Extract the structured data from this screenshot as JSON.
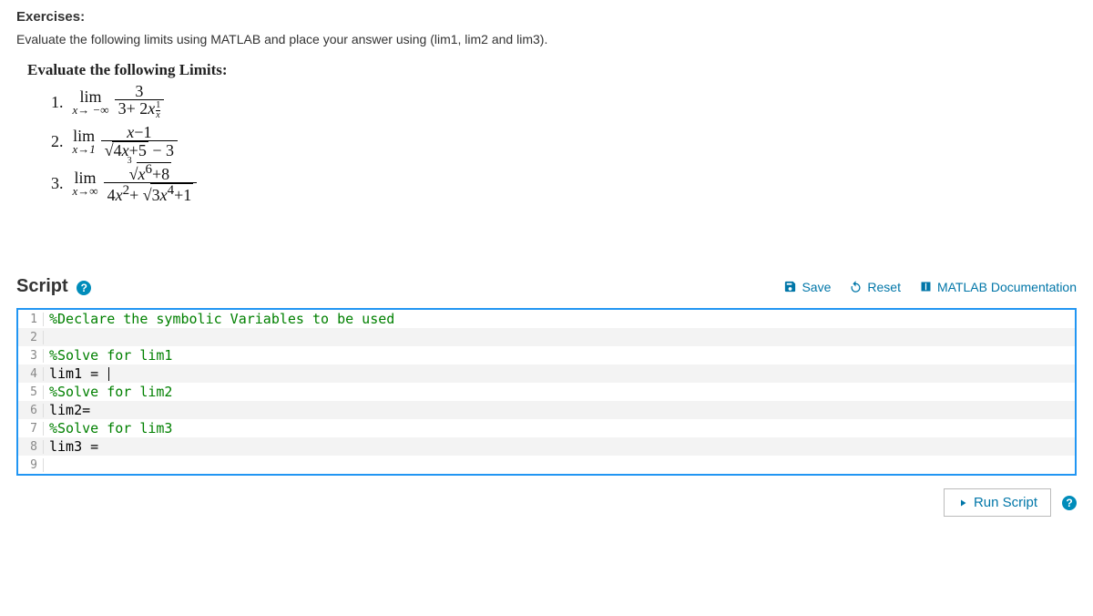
{
  "header": {
    "title": "Exercises:",
    "desc": "Evaluate the following limits using MATLAB and place your answer using (lim1, lim2 and lim3)."
  },
  "math": {
    "title": "Evaluate the following Limits:",
    "items": [
      {
        "n": "1.",
        "approach": "x→ −∞",
        "expr_top": "3",
        "expr_bot": "3 + 2x^(1/x)"
      },
      {
        "n": "2.",
        "approach": "x→1",
        "expr_top": "x − 1",
        "expr_bot": "√(4x+5) − 3"
      },
      {
        "n": "3.",
        "approach": "x→∞",
        "expr_top": "∛(x^6 + 8)",
        "expr_bot": "4x^2 + √(3x^4 + 1)"
      }
    ]
  },
  "script": {
    "title": "Script"
  },
  "toolbar": {
    "save": "Save",
    "reset": "Reset",
    "docs": "MATLAB Documentation",
    "run": "Run Script"
  },
  "editor": {
    "lines": [
      {
        "n": 1,
        "type": "comment",
        "text": "%Declare the symbolic Variables to be used"
      },
      {
        "n": 2,
        "type": "plain",
        "text": ""
      },
      {
        "n": 3,
        "type": "comment",
        "text": "%Solve for lim1"
      },
      {
        "n": 4,
        "type": "plain",
        "text": "lim1 = ",
        "cursor": true
      },
      {
        "n": 5,
        "type": "comment",
        "text": "%Solve for lim2"
      },
      {
        "n": 6,
        "type": "plain",
        "text": "lim2="
      },
      {
        "n": 7,
        "type": "comment",
        "text": "%Solve for lim3"
      },
      {
        "n": 8,
        "type": "plain",
        "text": "lim3 = "
      },
      {
        "n": 9,
        "type": "plain",
        "text": ""
      }
    ]
  }
}
